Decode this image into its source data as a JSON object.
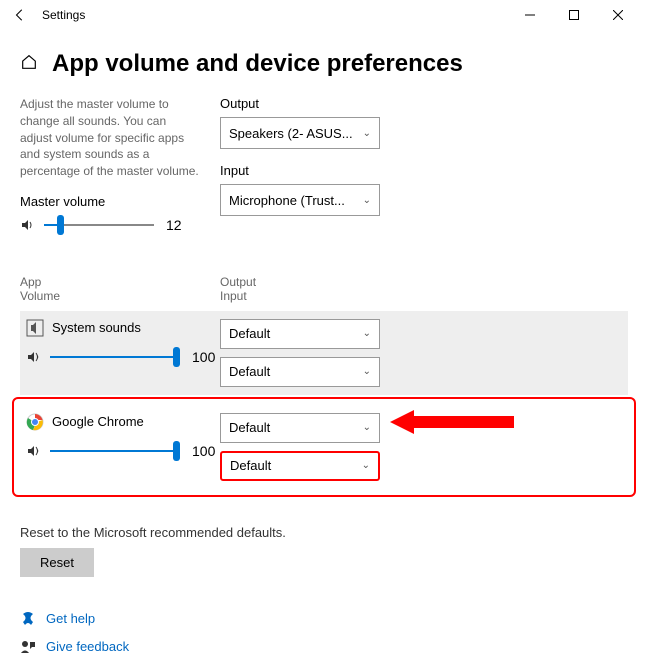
{
  "titlebar": {
    "title": "Settings"
  },
  "page": {
    "heading": "App volume and device preferences",
    "description": "Adjust the master volume to change all sounds. You can adjust volume for specific apps and system sounds as a percentage of the master volume.",
    "master_label": "Master volume",
    "master_value": "12",
    "output_label": "Output",
    "output_value": "Speakers (2- ASUS...",
    "input_label": "Input",
    "input_value": "Microphone (Trust..."
  },
  "table": {
    "col_app_l1": "App",
    "col_app_l2": "Volume",
    "col_out_l1": "Output",
    "col_out_l2": "Input"
  },
  "apps": {
    "system": {
      "name": "System sounds",
      "vol": "100",
      "out": "Default",
      "in": "Default"
    },
    "chrome": {
      "name": "Google Chrome",
      "vol": "100",
      "out": "Default",
      "in": "Default"
    }
  },
  "reset": {
    "label": "Reset to the Microsoft recommended defaults.",
    "button": "Reset"
  },
  "links": {
    "help": "Get help",
    "feedback": "Give feedback"
  }
}
